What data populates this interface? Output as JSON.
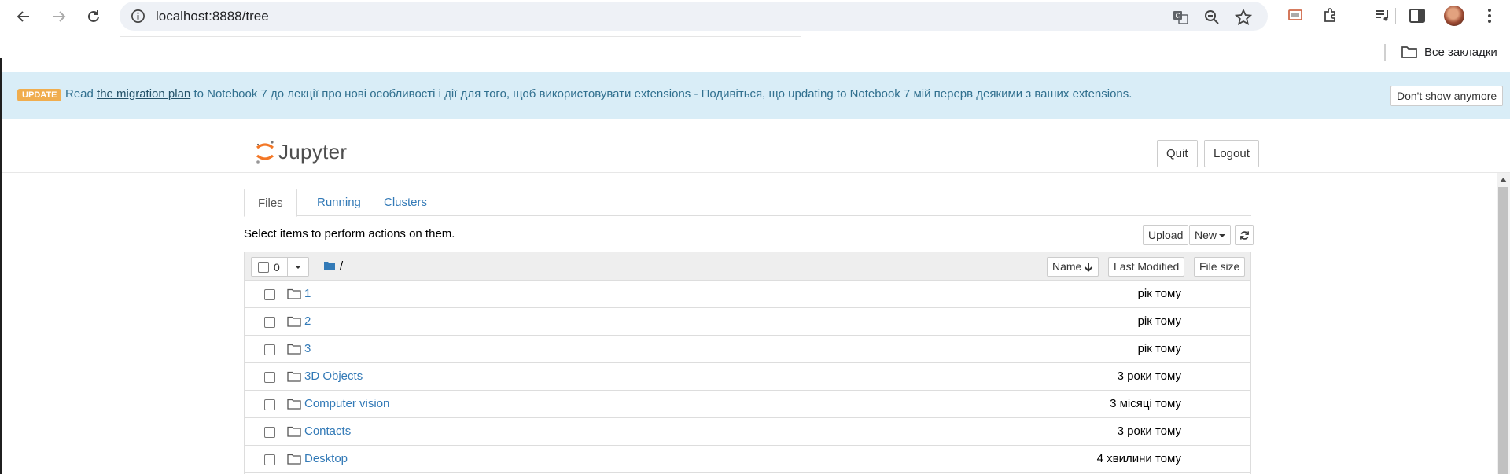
{
  "browser": {
    "url": "localhost:8888/tree",
    "bookmarks_all_label": "Все закладки"
  },
  "alert": {
    "badge": "UPDATE",
    "text_before": "Read ",
    "link": "the migration plan",
    "text_after": " to Notebook 7 до лекції про нові особливості і дії для того, щоб використовувати extensions - Подивіться, що updating to Notebook 7 мій перерв деякими з ваших extensions.",
    "dismiss_label": "Don't show anymore"
  },
  "header": {
    "logo_text": "Jupyter",
    "quit_label": "Quit",
    "logout_label": "Logout"
  },
  "tabs": [
    {
      "label": "Files",
      "active": true
    },
    {
      "label": "Running",
      "active": false
    },
    {
      "label": "Clusters",
      "active": false
    }
  ],
  "toolbar": {
    "hint": "Select items to perform actions on them.",
    "upload_label": "Upload",
    "new_label": "New"
  },
  "list_header": {
    "selected_count": "0",
    "breadcrumb": "/",
    "sort_name_label": "Name",
    "last_modified_label": "Last Modified",
    "file_size_label": "File size"
  },
  "files": [
    {
      "name": "1",
      "modified": "рік тому",
      "type": "folder"
    },
    {
      "name": "2",
      "modified": "рік тому",
      "type": "folder"
    },
    {
      "name": "3",
      "modified": "рік тому",
      "type": "folder"
    },
    {
      "name": "3D Objects",
      "modified": "3 роки тому",
      "type": "folder"
    },
    {
      "name": "Computer vision",
      "modified": "3 місяці тому",
      "type": "folder"
    },
    {
      "name": "Contacts",
      "modified": "3 роки тому",
      "type": "folder"
    },
    {
      "name": "Desktop",
      "modified": "4 хвилини тому",
      "type": "folder"
    }
  ],
  "colors": {
    "link": "#337ab7",
    "alert_bg": "#d9edf7",
    "alert_text": "#31708f",
    "badge": "#f0ad4e",
    "jupyter_orange": "#f37726"
  }
}
